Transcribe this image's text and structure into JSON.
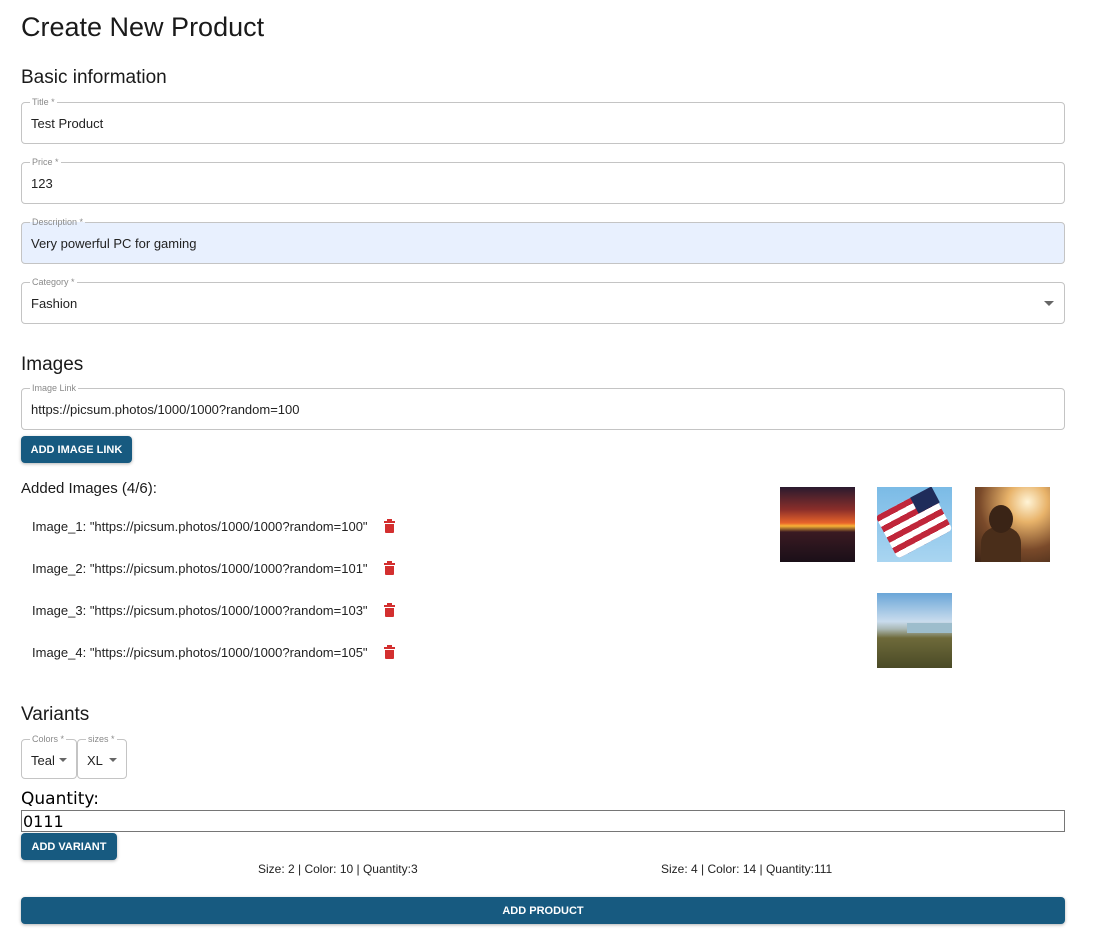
{
  "page": {
    "title": "Create New Product"
  },
  "basic": {
    "heading": "Basic information",
    "title_field": {
      "label": "Title *",
      "value": "Test Product"
    },
    "price_field": {
      "label": "Price *",
      "value": "123"
    },
    "description_field": {
      "label": "Description *",
      "value": "Very powerful PC for gaming"
    },
    "category_field": {
      "label": "Category *",
      "value": "Fashion"
    }
  },
  "images": {
    "heading": "Images",
    "link_field": {
      "label": "Image Link",
      "value": "https://picsum.photos/1000/1000?random=100"
    },
    "add_button": "ADD IMAGE LINK",
    "added_title": "Added Images (4/6):",
    "items": [
      {
        "label": "Image_1: \"https://picsum.photos/1000/1000?random=100\""
      },
      {
        "label": "Image_2: \"https://picsum.photos/1000/1000?random=101\""
      },
      {
        "label": "Image_3: \"https://picsum.photos/1000/1000?random=103\""
      },
      {
        "label": "Image_4: \"https://picsum.photos/1000/1000?random=105\""
      }
    ],
    "thumbnails": [
      "sunset-thumbnail",
      "flag-thumbnail",
      "person-thumbnail",
      "coast-thumbnail"
    ]
  },
  "variants": {
    "heading": "Variants",
    "colors_select": {
      "label": "Colors *",
      "value": "Teal"
    },
    "sizes_select": {
      "label": "sizes *",
      "value": "XL"
    },
    "quantity_label": "Quantity:",
    "quantity_value": "0111",
    "add_button": "ADD VARIANT",
    "summaries": [
      "Size: 2 | Color: 10 | Quantity:3",
      "Size: 4 | Color: 14 | Quantity:111"
    ]
  },
  "submit": {
    "label": "ADD PRODUCT"
  },
  "colors": {
    "primary": "#175a80",
    "danger": "#d32f2f",
    "autofill": "#e8f0fe"
  }
}
